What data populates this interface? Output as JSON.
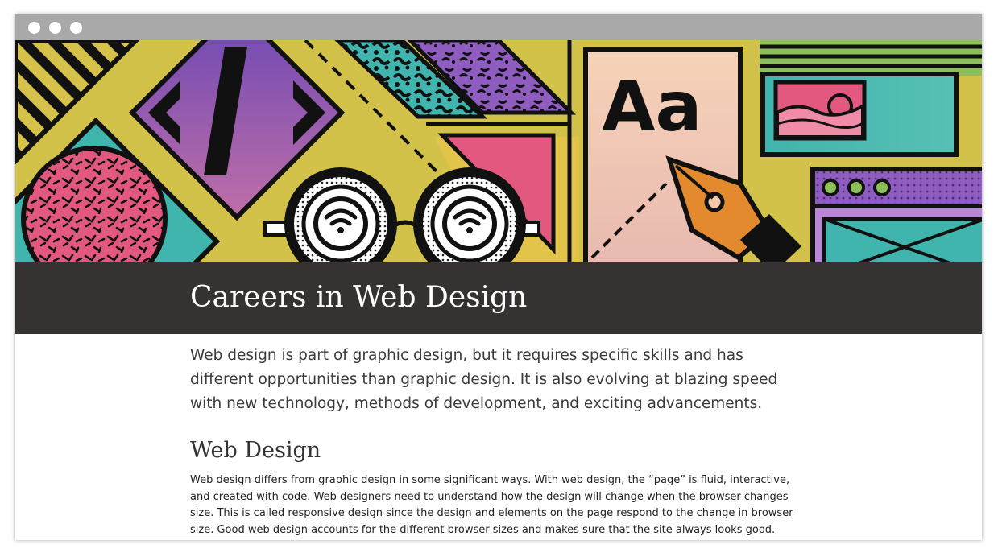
{
  "window": {
    "controls": [
      "close-dot",
      "minimize-dot",
      "maximize-dot"
    ]
  },
  "hero": {
    "description_icons": [
      "code-brackets-icon",
      "glasses-wifi-icon",
      "typography-aa-icon",
      "pen-nib-icon",
      "image-landscape-icon",
      "browser-window-icon"
    ],
    "letters": "Aa",
    "colors": {
      "background": "#d6c14a",
      "purple": "#7d4fb0",
      "teal": "#3fb5ad",
      "pink": "#e2587f",
      "orange": "#e3892e",
      "peach": "#f3c9aa",
      "black": "#111111"
    }
  },
  "header": {
    "title": "Careers in Web Design"
  },
  "article": {
    "intro": "Web design is part of graphic design, but it requires specific skills and has different opportunities than graphic design. It is also evolving at blazing speed with new technology, methods of development, and exciting advancements.",
    "section_heading": "Web Design",
    "section_body": "Web design differs from graphic design in some significant ways. With web design, the “page” is fluid, interactive, and created with code. Web designers need to understand how the design will change when the browser changes size. This is called responsive design since the design and elements on the page respond to the change in browser size. Good web design accounts for the different browser sizes and makes sure that the site always looks good."
  }
}
